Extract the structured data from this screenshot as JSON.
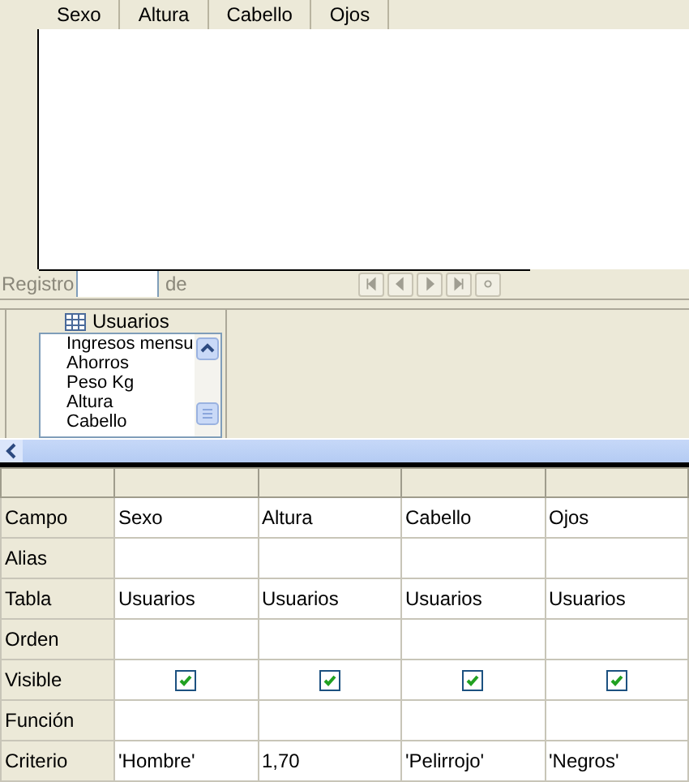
{
  "result_grid": {
    "columns": [
      "Sexo",
      "Altura",
      "Cabello",
      "Ojos"
    ]
  },
  "record_navigator": {
    "label": "Registro",
    "of_label": "de"
  },
  "table_widget": {
    "title": "Usuarios",
    "fields": [
      "Ingresos mensu",
      "Ahorros",
      "Peso Kg",
      "Altura",
      "Cabello"
    ]
  },
  "design_grid": {
    "rows": [
      {
        "label": "Campo",
        "kind": "text",
        "cells": [
          "Sexo",
          "Altura",
          "Cabello",
          "Ojos"
        ]
      },
      {
        "label": "Alias",
        "kind": "blank"
      },
      {
        "label": "Tabla",
        "kind": "text",
        "cells": [
          "Usuarios",
          "Usuarios",
          "Usuarios",
          "Usuarios"
        ]
      },
      {
        "label": "Orden",
        "kind": "blank"
      },
      {
        "label": "Visible",
        "kind": "checkbox",
        "checked": [
          true,
          true,
          true,
          true
        ]
      },
      {
        "label": "Función",
        "kind": "blank"
      },
      {
        "label": "Criterio",
        "kind": "text",
        "cells": [
          "'Hombre'",
          "1,70",
          "'Pelirrojo'",
          "'Negros'"
        ]
      }
    ]
  }
}
